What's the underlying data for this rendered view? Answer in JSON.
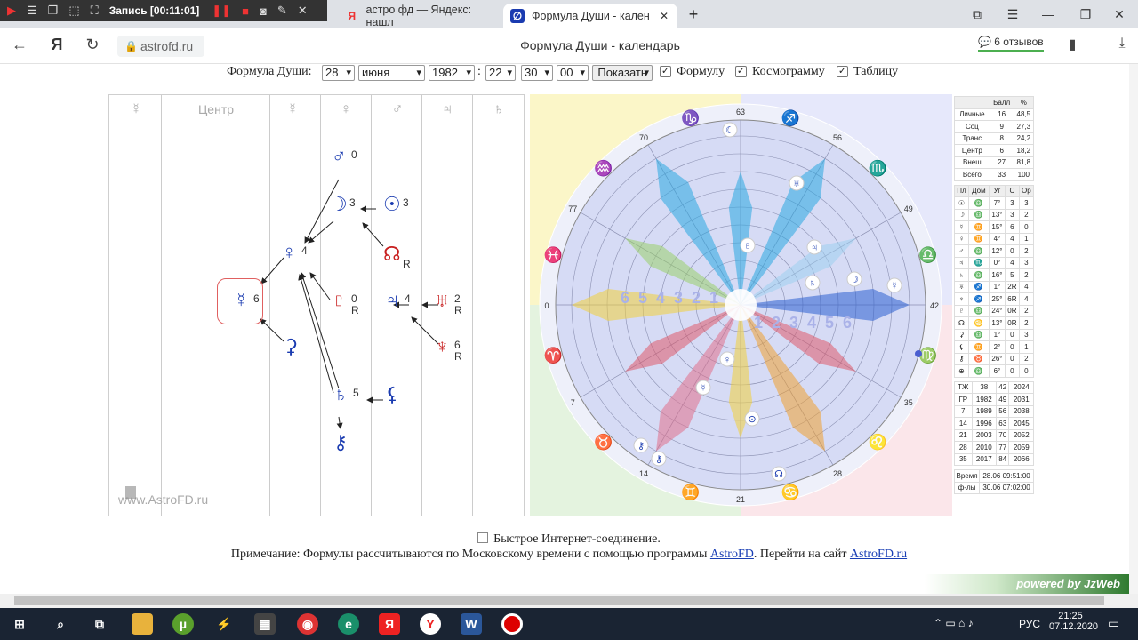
{
  "recorder": {
    "label": "Запись [00:11:01]"
  },
  "tabs": [
    {
      "label": "астро фд — Яндекс: нашл"
    },
    {
      "label": "Формула Души - кален"
    }
  ],
  "address": {
    "domain": "astrofd.ru",
    "page_title": "Формула Души - календарь",
    "reviews": "6 отзывов"
  },
  "form": {
    "label": "Формула Души:",
    "day": "28",
    "month": "июня",
    "year": "1982",
    "sep": ":",
    "hour": "22",
    "minute": "30",
    "second": "00",
    "show_button": "Показать",
    "cb_formula": "Формулу",
    "cb_cosmogram": "Космограмму",
    "cb_table": "Таблицу"
  },
  "formula": {
    "center_label": "Центр",
    "watermark": "www.AstroFD.ru",
    "header_glyphs": [
      "☿",
      "☿",
      "♀",
      "♂",
      "♃",
      "♄"
    ],
    "planets": [
      {
        "g": "♂",
        "n": "0",
        "r": "",
        "c": "#1a3bb0"
      },
      {
        "g": "☽",
        "n": "3",
        "r": "",
        "c": "#1a3bb0"
      },
      {
        "g": "☉",
        "n": "3",
        "r": "",
        "c": "#1a3bb0"
      },
      {
        "g": "♀",
        "n": "4",
        "r": "",
        "c": "#1a3bb0"
      },
      {
        "g": "☊",
        "n": "",
        "r": "R",
        "c": "#c82020"
      },
      {
        "g": "☿",
        "n": "6",
        "r": "",
        "c": "#1a3bb0"
      },
      {
        "g": "♇",
        "n": "0",
        "r": "R",
        "c": "#c82020"
      },
      {
        "g": "♃",
        "n": "4",
        "r": "",
        "c": "#1a3bb0"
      },
      {
        "g": "♅",
        "n": "2",
        "r": "R",
        "c": "#c82020"
      },
      {
        "g": "♆",
        "n": "6",
        "r": "R",
        "c": "#c82020"
      },
      {
        "g": "⚳",
        "n": "",
        "r": "",
        "c": "#1a3bb0"
      },
      {
        "g": "♄",
        "n": "5",
        "r": "",
        "c": "#1a3bb0"
      },
      {
        "g": "⚸",
        "n": "",
        "r": "",
        "c": "#1a3bb0"
      },
      {
        "g": "⚷",
        "n": "",
        "r": "",
        "c": "#1a3bb0"
      }
    ]
  },
  "wheel": {
    "degrees": [
      "63",
      "56",
      "49",
      "42",
      "35",
      "28",
      "21",
      "14",
      "7",
      "0",
      "77",
      "70"
    ],
    "signs": [
      "♐",
      "♏",
      "♎",
      "♍",
      "♌",
      "♋",
      "♊",
      "♉",
      "♈",
      "♓",
      "♒",
      "♑"
    ],
    "ring_numbers": [
      "6",
      "5",
      "4",
      "3",
      "2",
      "1"
    ]
  },
  "stats": {
    "summary": [
      [
        "",
        "Балл",
        "%"
      ],
      [
        "Личные",
        "16",
        "48,5"
      ],
      [
        "Соц",
        "9",
        "27,3"
      ],
      [
        "Транс",
        "8",
        "24,2"
      ],
      [
        "Центр",
        "6",
        "18,2"
      ],
      [
        "Внеш",
        "27",
        "81,8"
      ],
      [
        "Всего",
        "33",
        "100"
      ]
    ],
    "planets_head": [
      "Пл",
      "Дом",
      "Уг",
      "С",
      "Ор"
    ],
    "planets": [
      [
        "☉",
        "♎",
        "7°",
        "3",
        "3"
      ],
      [
        "☽",
        "♎",
        "13°",
        "3",
        "2"
      ],
      [
        "☿",
        "♊",
        "15°",
        "6",
        "0"
      ],
      [
        "♀",
        "♊",
        "4°",
        "4",
        "1"
      ],
      [
        "♂",
        "♎",
        "12°",
        "0",
        "2"
      ],
      [
        "♃",
        "♏",
        "0°",
        "4",
        "3"
      ],
      [
        "♄",
        "♎",
        "16°",
        "5",
        "2"
      ],
      [
        "♅",
        "♐",
        "1°",
        "2R",
        "4"
      ],
      [
        "♆",
        "♐",
        "25°",
        "6R",
        "4"
      ],
      [
        "♇",
        "♎",
        "24°",
        "0R",
        "2"
      ],
      [
        "☊",
        "♋",
        "13°",
        "0R",
        "2"
      ],
      [
        "⚳",
        "♎",
        "1°",
        "0",
        "3"
      ],
      [
        "⚸",
        "♊",
        "2°",
        "0",
        "1"
      ],
      [
        "⚷",
        "♉",
        "26°",
        "0",
        "2"
      ],
      [
        "⊕",
        "♎",
        "6°",
        "0",
        "0"
      ]
    ],
    "ages": [
      [
        "ТЖ",
        "38",
        "42",
        "2024"
      ],
      [
        "ГР",
        "1982",
        "49",
        "2031"
      ],
      [
        "7",
        "1989",
        "56",
        "2038"
      ],
      [
        "14",
        "1996",
        "63",
        "2045"
      ],
      [
        "21",
        "2003",
        "70",
        "2052"
      ],
      [
        "28",
        "2010",
        "77",
        "2059"
      ],
      [
        "35",
        "2017",
        "84",
        "2066"
      ]
    ],
    "times": [
      [
        "Время",
        "28.06 09:51:00"
      ],
      [
        "ф-лы",
        "30.06 07:02:00"
      ]
    ]
  },
  "footer": {
    "fast_label": "Быстрое Интернет-соединение.",
    "note_pre": "Примечание: Формулы рассчитываются по Московскому времени с помощью программы ",
    "link1": "AstroFD",
    "note_mid": ". Перейти на сайт ",
    "link2": "AstroFD.ru",
    "powered": "powered by JzWeb"
  },
  "taskbar": {
    "lang": "РУС",
    "time": "21:25",
    "date": "07.12.2020"
  }
}
